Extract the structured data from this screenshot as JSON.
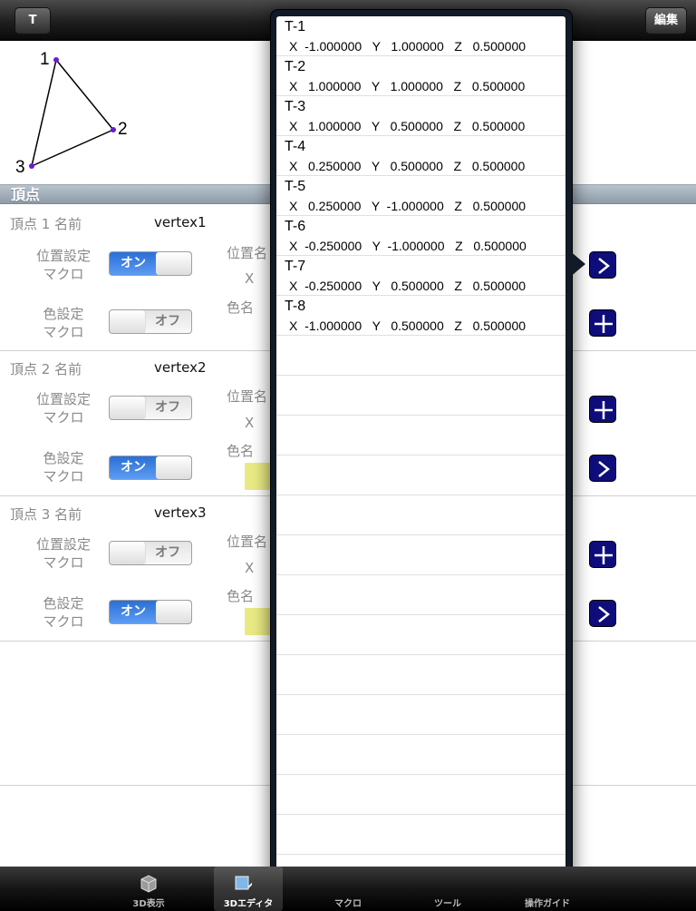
{
  "navbar": {
    "back_label": "T",
    "edit_label": "編集"
  },
  "preview": {
    "labels": [
      "1",
      "2",
      "3"
    ]
  },
  "section": {
    "title": "頂点"
  },
  "vertices": [
    {
      "name_label": "頂点 1 名前",
      "name_value": "vertex1",
      "position_macro_label_1": "位置設定",
      "position_macro_label_2": "マクロ",
      "position_switch": "オン",
      "color_macro_label_1": "色設定",
      "color_macro_label_2": "マクロ",
      "color_switch": "オフ",
      "position_name_label": "位置名",
      "x_label": "X",
      "color_name_label": "色名"
    },
    {
      "name_label": "頂点 2 名前",
      "name_value": "vertex2",
      "position_macro_label_1": "位置設定",
      "position_macro_label_2": "マクロ",
      "position_switch": "オフ",
      "color_macro_label_1": "色設定",
      "color_macro_label_2": "マクロ",
      "color_switch": "オン",
      "position_name_label": "位置名",
      "x_label": "X",
      "color_name_label": "色名"
    },
    {
      "name_label": "頂点 3 名前",
      "name_value": "vertex3",
      "position_macro_label_1": "位置設定",
      "position_macro_label_2": "マクロ",
      "position_switch": "オフ",
      "color_macro_label_1": "色設定",
      "color_macro_label_2": "マクロ",
      "color_switch": "オン",
      "position_name_label": "位置名",
      "x_label": "X",
      "color_name_label": "色名"
    }
  ],
  "popover": {
    "items": [
      {
        "title": "T-1",
        "coords": "X  -1.000000   Y   1.000000   Z   0.500000"
      },
      {
        "title": "T-2",
        "coords": "X   1.000000   Y   1.000000   Z   0.500000"
      },
      {
        "title": "T-3",
        "coords": "X   1.000000   Y   0.500000   Z   0.500000"
      },
      {
        "title": "T-4",
        "coords": "X   0.250000   Y   0.500000   Z   0.500000"
      },
      {
        "title": "T-5",
        "coords": "X   0.250000   Y  -1.000000   Z   0.500000"
      },
      {
        "title": "T-6",
        "coords": "X  -0.250000   Y  -1.000000   Z   0.500000"
      },
      {
        "title": "T-7",
        "coords": "X  -0.250000   Y   0.500000   Z   0.500000"
      },
      {
        "title": "T-8",
        "coords": "X  -1.000000   Y   0.500000   Z   0.500000"
      }
    ]
  },
  "tabbar": {
    "tabs": [
      {
        "label": "3D表示",
        "icon": "cube-icon"
      },
      {
        "label": "3Dエディタ",
        "icon": "editor-icon"
      },
      {
        "label": "マクロ",
        "icon": "macro-icon"
      },
      {
        "label": "ツール",
        "icon": "tool-icon"
      },
      {
        "label": "操作ガイド",
        "icon": "guide-icon"
      }
    ]
  },
  "colors": {
    "switch_on": "#2a6fd6",
    "macro_button": "#0e0d7a",
    "color_swatch": "#eaea85"
  }
}
